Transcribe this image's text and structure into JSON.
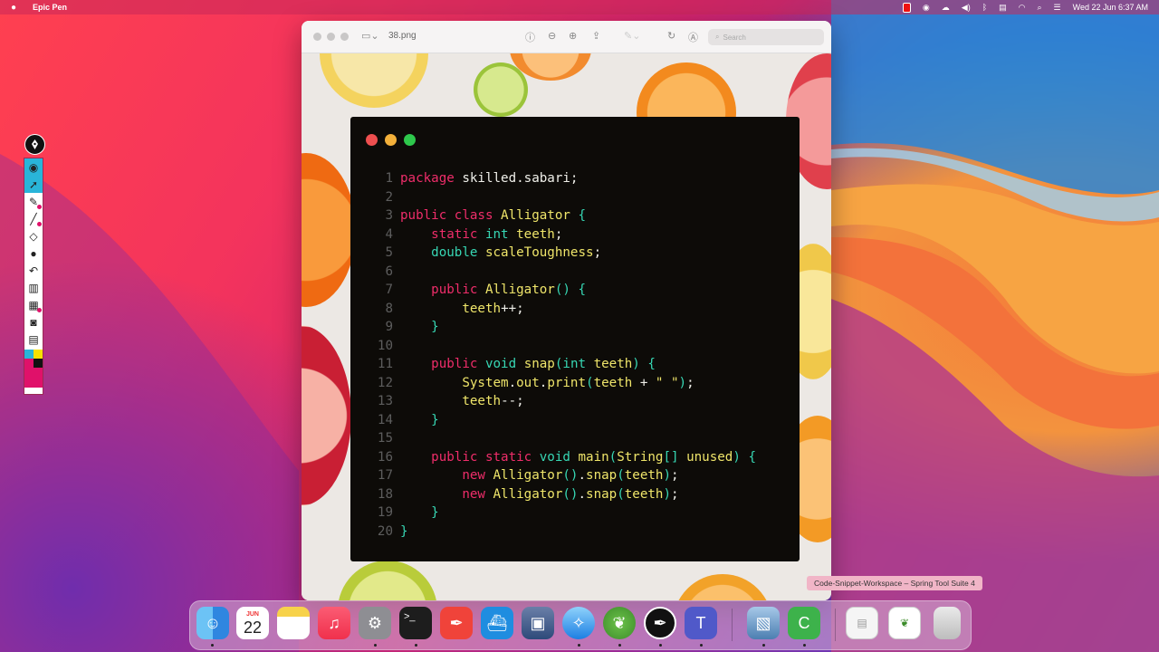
{
  "menubar": {
    "app_name": "Epic Pen",
    "clock": "Wed 22 Jun  6:37 AM"
  },
  "epic_pen": {
    "tools": [
      "eye",
      "cursor",
      "pen",
      "highlighter",
      "eraser",
      "dot",
      "undo",
      "trash",
      "board",
      "camera",
      "clipboard"
    ]
  },
  "preview": {
    "title": "38.png",
    "search_placeholder": "Search"
  },
  "code": {
    "lines": [
      "package skilled.sabari;",
      "",
      "public class Alligator {",
      "    static int teeth;",
      "    double scaleToughness;",
      "",
      "    public Alligator() {",
      "        teeth++;",
      "    }",
      "",
      "    public void snap(int teeth) {",
      "        System.out.print(teeth + \" \");",
      "        teeth--;",
      "    }",
      "",
      "    public static void main(String[] unused) {",
      "        new Alligator().snap(teeth);",
      "        new Alligator().snap(teeth);",
      "    }",
      "}"
    ]
  },
  "tooltip": "Code-Snippet-Workspace – Spring Tool Suite 4",
  "dock": {
    "calendar_month": "JUN",
    "calendar_day": "22",
    "apps": [
      "Finder",
      "Calendar",
      "Notes",
      "Music",
      "System Preferences",
      "Terminal",
      "Pen Tool",
      "Docker",
      "VirtualBox",
      "Safari",
      "Spring Tool Suite 4",
      "Epic Pen",
      "Teams",
      "Preview",
      "Codeshot",
      "Workspace Window",
      "Spring Window",
      "Trash"
    ]
  }
}
